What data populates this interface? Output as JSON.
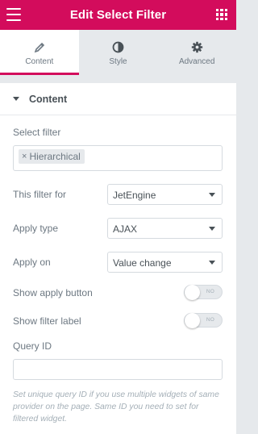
{
  "header": {
    "title": "Edit Select Filter",
    "menu_icon": "hamburger-menu-icon",
    "apps_icon": "grid-apps-icon",
    "background": "#d30c5c"
  },
  "tabs": [
    {
      "label": "Content",
      "icon": "pencil-icon",
      "active": true
    },
    {
      "label": "Style",
      "icon": "half-circle-icon",
      "active": false
    },
    {
      "label": "Advanced",
      "icon": "gear-icon",
      "active": false
    }
  ],
  "section": {
    "title": "Content",
    "collapse_icon": "caret-down-icon"
  },
  "fields": {
    "select_filter": {
      "label": "Select filter",
      "chips": [
        {
          "remove_glyph": "×",
          "label": "Hierarchical"
        }
      ]
    },
    "this_filter_for": {
      "label": "This filter for",
      "value": "JetEngine"
    },
    "apply_type": {
      "label": "Apply type",
      "value": "AJAX"
    },
    "apply_on": {
      "label": "Apply on",
      "value": "Value change"
    },
    "show_apply_button": {
      "label": "Show apply button",
      "toggle_text": "NO"
    },
    "show_filter_label": {
      "label": "Show filter label",
      "toggle_text": "NO"
    },
    "query_id": {
      "label": "Query ID",
      "value": "",
      "description": "Set unique query ID if you use multiple widgets of same provider on the page. Same ID you need to set for filtered widget."
    }
  },
  "colors": {
    "accent": "#d30c5c",
    "panel_bg": "#e6e9ec",
    "text": "#6d7882",
    "muted": "#a4afb7"
  }
}
